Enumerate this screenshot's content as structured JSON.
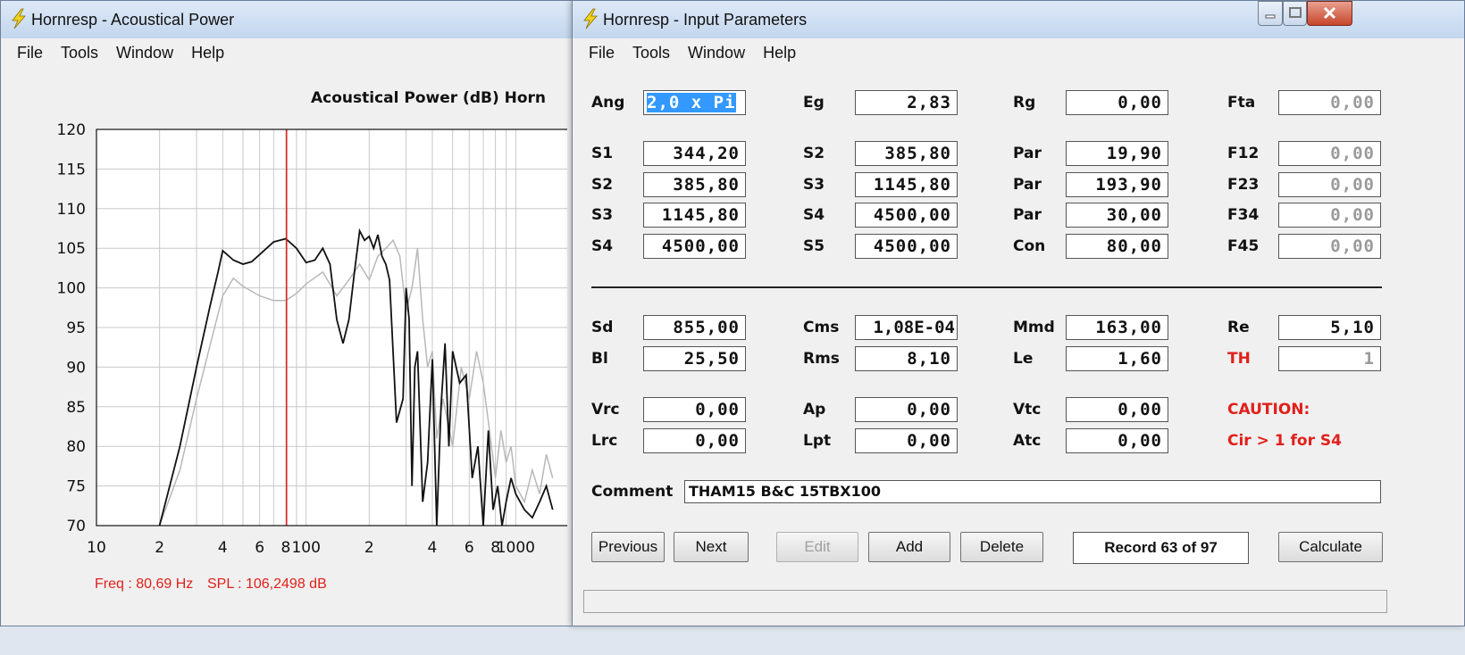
{
  "power_window": {
    "title": "Hornresp - Acoustical Power",
    "menu": [
      "File",
      "Tools",
      "Window",
      "Help"
    ],
    "status_freq": "Freq : 80,69 Hz",
    "status_spl": "SPL : 106,2498 dB"
  },
  "chart_data": {
    "type": "line",
    "title": "Acoustical Power (dB)   Horn",
    "x_scale": "log",
    "xlim": [
      10,
      2000
    ],
    "ylim": [
      70,
      120
    ],
    "y_ticks": [
      70,
      75,
      80,
      85,
      90,
      95,
      100,
      105,
      110,
      115,
      120
    ],
    "x_ticks": [
      10,
      20,
      40,
      60,
      80,
      100,
      200,
      400,
      600,
      800,
      1000
    ],
    "x_tick_labels": [
      "10",
      "2",
      "4",
      "6",
      "8",
      "100",
      "2",
      "4",
      "6",
      "8",
      "1000"
    ],
    "grid": true,
    "cursor": {
      "freq": 80.69,
      "spl": 106.2498,
      "color": "#e0201a"
    },
    "series": [
      {
        "color": "#111111",
        "x": [
          20,
          25,
          30,
          35,
          38,
          40,
          45,
          50,
          55,
          60,
          70,
          80,
          90,
          100,
          110,
          120,
          130,
          140,
          150,
          160,
          170,
          180,
          190,
          200,
          210,
          220,
          230,
          240,
          250,
          270,
          290,
          300,
          310,
          320,
          330,
          340,
          360,
          380,
          400,
          420,
          440,
          460,
          480,
          500,
          540,
          580,
          620,
          660,
          700,
          740,
          780,
          820,
          860,
          900,
          950,
          1000,
          1100,
          1200,
          1300,
          1400,
          1500
        ],
        "y": [
          70,
          80,
          90,
          98,
          102,
          104.7,
          103.5,
          103.0,
          103.3,
          104.2,
          105.8,
          106.2,
          105,
          103.2,
          103.5,
          105,
          103,
          96,
          93,
          96,
          102,
          107.2,
          106,
          106.5,
          105,
          106.7,
          104,
          103,
          101,
          83,
          86,
          100,
          96,
          75,
          90,
          92,
          73,
          78,
          91,
          70,
          85,
          93,
          80,
          92,
          88,
          89,
          76,
          80,
          70,
          82,
          72,
          75,
          70,
          73,
          76,
          74,
          72,
          71,
          73,
          75,
          72
        ]
      },
      {
        "color": "#b8b8b8",
        "x": [
          20,
          25,
          30,
          35,
          40,
          45,
          50,
          60,
          70,
          80,
          90,
          100,
          120,
          140,
          160,
          180,
          200,
          220,
          240,
          260,
          280,
          300,
          320,
          340,
          360,
          380,
          400,
          420,
          450,
          500,
          550,
          600,
          650,
          700,
          750,
          800,
          850,
          900,
          950,
          1000,
          1100,
          1200,
          1300,
          1400,
          1500
        ],
        "y": [
          70,
          77,
          86,
          93,
          99,
          101.2,
          100.2,
          99.0,
          98.4,
          98.4,
          99.3,
          100.5,
          102,
          99,
          101,
          103,
          101,
          104,
          105,
          106,
          104,
          97,
          100,
          105,
          96,
          90,
          92,
          81,
          86,
          80,
          90,
          86,
          92,
          88,
          82,
          76,
          82,
          78,
          80,
          75,
          73,
          77,
          74,
          79,
          76
        ]
      }
    ]
  },
  "params_window": {
    "title": "Hornresp - Input Parameters",
    "menu": [
      "File",
      "Tools",
      "Window",
      "Help"
    ],
    "row_ang": [
      {
        "label": "Ang",
        "value": "2,0 x Pi",
        "selected": true
      },
      {
        "label": "Eg",
        "value": "2,83"
      },
      {
        "label": "Rg",
        "value": "0,00"
      },
      {
        "label": "Fta",
        "value": "0,00",
        "disabled": true
      }
    ],
    "rows_horn": [
      [
        {
          "label": "S1",
          "value": "344,20"
        },
        {
          "label": "S2",
          "value": "385,80"
        },
        {
          "label": "Par",
          "value": "19,90"
        },
        {
          "label": "F12",
          "value": "0,00",
          "disabled": true
        }
      ],
      [
        {
          "label": "S2",
          "value": "385,80"
        },
        {
          "label": "S3",
          "value": "1145,80"
        },
        {
          "label": "Par",
          "value": "193,90"
        },
        {
          "label": "F23",
          "value": "0,00",
          "disabled": true
        }
      ],
      [
        {
          "label": "S3",
          "value": "1145,80"
        },
        {
          "label": "S4",
          "value": "4500,00"
        },
        {
          "label": "Par",
          "value": "30,00"
        },
        {
          "label": "F34",
          "value": "0,00",
          "disabled": true
        }
      ],
      [
        {
          "label": "S4",
          "value": "4500,00"
        },
        {
          "label": "S5",
          "value": "4500,00"
        },
        {
          "label": "Con",
          "value": "80,00"
        },
        {
          "label": "F45",
          "value": "0,00",
          "disabled": true
        }
      ]
    ],
    "rows_driver": [
      [
        {
          "label": "Sd",
          "value": "855,00"
        },
        {
          "label": "Cms",
          "value": "1,08E-04"
        },
        {
          "label": "Mmd",
          "value": "163,00"
        },
        {
          "label": "Re",
          "value": "5,10"
        }
      ],
      [
        {
          "label": "Bl",
          "value": "25,50"
        },
        {
          "label": "Rms",
          "value": "8,10"
        },
        {
          "label": "Le",
          "value": "1,60"
        },
        {
          "label": "TH",
          "value": "1",
          "disabled": true,
          "red": true
        }
      ]
    ],
    "rows_chamber": [
      [
        {
          "label": "Vrc",
          "value": "0,00"
        },
        {
          "label": "Ap",
          "value": "0,00"
        },
        {
          "label": "Vtc",
          "value": "0,00"
        }
      ],
      [
        {
          "label": "Lrc",
          "value": "0,00"
        },
        {
          "label": "Lpt",
          "value": "0,00"
        },
        {
          "label": "Atc",
          "value": "0,00"
        }
      ]
    ],
    "caution_title": "CAUTION:",
    "caution_msg": "Cir > 1 for S4",
    "comment_label": "Comment",
    "comment_value": "THAM15 B&C 15TBX100",
    "buttons": {
      "previous": "Previous",
      "next": "Next",
      "edit": "Edit",
      "add": "Add",
      "delete": "Delete",
      "calculate": "Calculate"
    },
    "record": "Record 63 of 97",
    "status": ""
  }
}
